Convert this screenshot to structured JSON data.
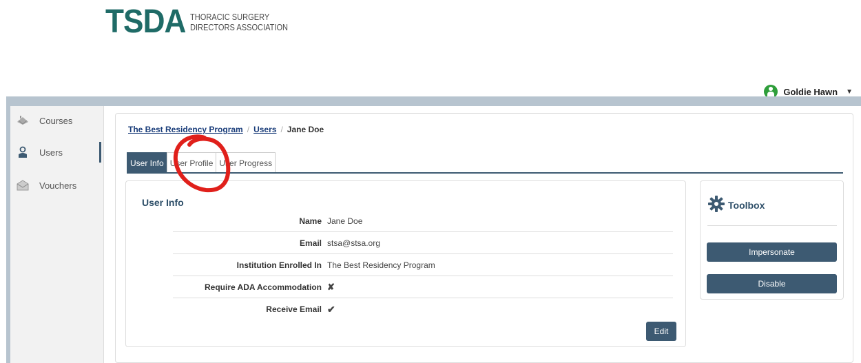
{
  "brand": {
    "mark": "TSDA",
    "line1": "THORACIC SURGERY",
    "line2": "DIRECTORS ASSOCIATION",
    "color": "#1f6b67"
  },
  "user_menu": {
    "name": "Goldie Hawn",
    "avatar_icon": "user-circle-icon"
  },
  "sidebar": {
    "items": [
      {
        "label": "Courses",
        "icon": "courses-icon"
      },
      {
        "label": "Users",
        "icon": "user-icon",
        "active": true
      },
      {
        "label": "Vouchers",
        "icon": "voucher-icon"
      }
    ]
  },
  "breadcrumb": {
    "items": [
      "The Best Residency Program",
      "Users"
    ],
    "current": "Jane Doe"
  },
  "tabs": [
    {
      "label": "User Info",
      "active": true
    },
    {
      "label": "User Profile"
    },
    {
      "label": "User Progress"
    }
  ],
  "user_info": {
    "title": "User Info",
    "rows": [
      {
        "label": "Name",
        "value": "Jane Doe"
      },
      {
        "label": "Email",
        "value": "stsa@stsa.org"
      },
      {
        "label": "Institution Enrolled In",
        "value": "The Best Residency Program"
      },
      {
        "label": "Require ADA Accommodation",
        "value": "✘"
      },
      {
        "label": "Receive Email",
        "value": "✔"
      }
    ],
    "edit_label": "Edit"
  },
  "toolbox": {
    "title": "Toolbox",
    "impersonate_label": "Impersonate",
    "disable_label": "Disable"
  },
  "colors": {
    "accent": "#3d5a72",
    "annotation": "#e0201b"
  }
}
